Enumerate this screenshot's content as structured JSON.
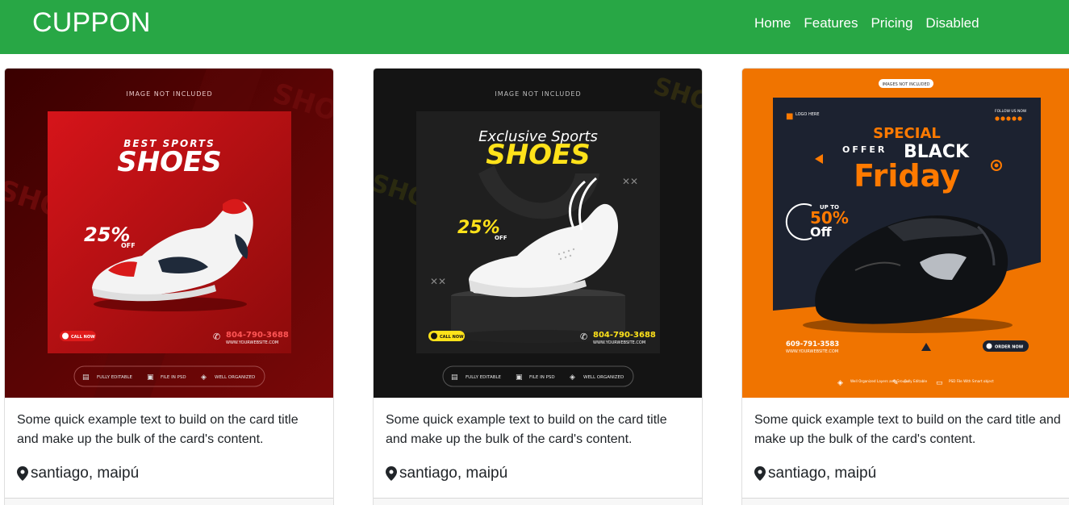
{
  "brand": "CUPPON",
  "nav": [
    {
      "label": "Home"
    },
    {
      "label": "Features"
    },
    {
      "label": "Pricing"
    },
    {
      "label": "Disabled"
    }
  ],
  "cards": [
    {
      "text": "Some quick example text to build on the card title and make up the bulk of the card's content.",
      "location": "santiago, maipú",
      "banner": {
        "top_note": "IMAGE NOT INCLUDED",
        "line1": "BEST SPORTS",
        "line2": "SHOES",
        "discount": "25%",
        "discount_sub": "OFF",
        "cta": "CALL NOW",
        "phone": "804-790-3688",
        "website": "WWW.YOURWEBSITE.COM",
        "features": [
          "FULLY EDITABLE",
          "FILE IN PSD",
          "WELL ORGANIZED"
        ],
        "accent": "#e01b1b"
      }
    },
    {
      "text": "Some quick example text to build on the card title and make up the bulk of the card's content.",
      "location": "santiago, maipú",
      "banner": {
        "top_note": "IMAGE NOT INCLUDED",
        "line1": "Exclusive Sports",
        "line2": "SHOES",
        "discount": "25%",
        "discount_sub": "OFF",
        "cta": "CALL NOW",
        "phone": "804-790-3688",
        "website": "WWW.YOURWEBSITE.COM",
        "features": [
          "FULLY EDITABLE",
          "FILE IN PSD",
          "WELL ORGANIZED"
        ],
        "accent": "#ffe21a"
      }
    },
    {
      "text": "Some quick example text to build on the card title and make up the bulk of the card's content.",
      "location": "santiago, maipú",
      "banner": {
        "top_note": "IMAGES NOT INCLUDED",
        "logo": "LOGO HERE",
        "follow": "FOLLOW US NOW",
        "line1": "SPECIAL",
        "line2a": "OFFER",
        "line2b": "BLACK",
        "line3": "Friday",
        "upto": "UP TO",
        "discount": "50%",
        "discount_sub": "Off",
        "phone": "609-791-3583",
        "website": "WWW.YOURWEBSITE.COM",
        "cta": "ORDER NOW",
        "features": [
          "Well Organized Layers and Groups",
          "Fully Editable",
          "PSD File With Smart object"
        ],
        "accent": "#ff7a00"
      }
    }
  ]
}
